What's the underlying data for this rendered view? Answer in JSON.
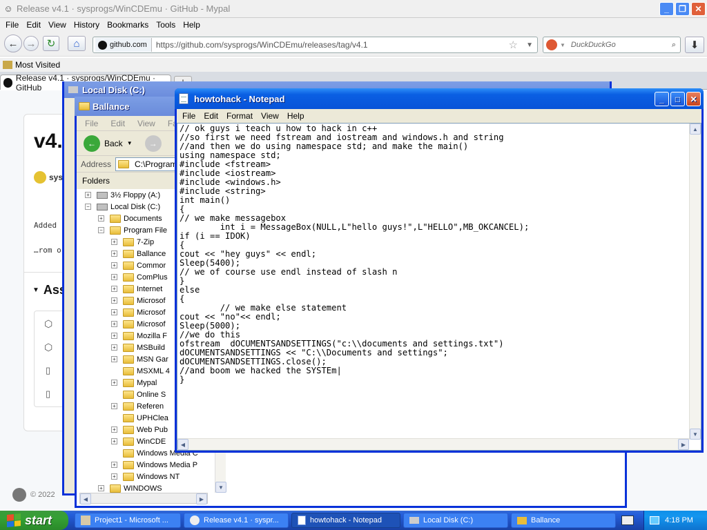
{
  "browser": {
    "title": "Release v4.1 · sysprogs/WinCDEmu · GitHub - Mypal",
    "menu": [
      "File",
      "Edit",
      "View",
      "History",
      "Bookmarks",
      "Tools",
      "Help"
    ],
    "site_identity": "github.com",
    "url": "https://github.com/sysprogs/WinCDEmu/releases/tag/v4.1",
    "search_placeholder": "DuckDuckGo",
    "bookmark": "Most Visited",
    "tab_label": "Release v4.1 · sysprogs/WinCDEmu · GitHub",
    "page": {
      "heading": "v4.",
      "author": "sys",
      "added": "Added",
      "from": "…rom o",
      "assets": "Ass",
      "footer": "© 2022"
    }
  },
  "localdisk": {
    "title": "Local Disk (C:)"
  },
  "ballance": {
    "title": "Ballance",
    "menu": [
      "File",
      "Edit",
      "View",
      "Favo"
    ],
    "back_label": "Back",
    "address_label": "Address",
    "address_value": "C:\\Program Fi",
    "folders_label": "Folders",
    "tree": [
      {
        "label": "3½ Floppy (A:)",
        "indent": 1,
        "pm": "+",
        "kind": "drive"
      },
      {
        "label": "Local Disk (C:)",
        "indent": 1,
        "pm": "-",
        "kind": "drive"
      },
      {
        "label": "Documents",
        "indent": 2,
        "pm": "+",
        "kind": "folder"
      },
      {
        "label": "Program File",
        "indent": 2,
        "pm": "-",
        "kind": "folder"
      },
      {
        "label": "7-Zip",
        "indent": 3,
        "pm": "+",
        "kind": "folder"
      },
      {
        "label": "Ballance",
        "indent": 3,
        "pm": "+",
        "kind": "folder"
      },
      {
        "label": "Commor",
        "indent": 3,
        "pm": "+",
        "kind": "folder"
      },
      {
        "label": "ComPlus",
        "indent": 3,
        "pm": "+",
        "kind": "folder"
      },
      {
        "label": "Internet",
        "indent": 3,
        "pm": "+",
        "kind": "folder"
      },
      {
        "label": "Microsof",
        "indent": 3,
        "pm": "+",
        "kind": "folder"
      },
      {
        "label": "Microsof",
        "indent": 3,
        "pm": "+",
        "kind": "folder"
      },
      {
        "label": "Microsof",
        "indent": 3,
        "pm": "+",
        "kind": "folder"
      },
      {
        "label": "Mozilla F",
        "indent": 3,
        "pm": "+",
        "kind": "folder"
      },
      {
        "label": "MSBuild",
        "indent": 3,
        "pm": "+",
        "kind": "folder"
      },
      {
        "label": "MSN Gar",
        "indent": 3,
        "pm": "+",
        "kind": "folder"
      },
      {
        "label": "MSXML 4",
        "indent": 3,
        "pm": "",
        "kind": "folder"
      },
      {
        "label": "Mypal",
        "indent": 3,
        "pm": "+",
        "kind": "folder"
      },
      {
        "label": "Online S",
        "indent": 3,
        "pm": "",
        "kind": "folder"
      },
      {
        "label": "Referen",
        "indent": 3,
        "pm": "+",
        "kind": "folder"
      },
      {
        "label": "UPHClea",
        "indent": 3,
        "pm": "",
        "kind": "folder"
      },
      {
        "label": "Web Pub",
        "indent": 3,
        "pm": "+",
        "kind": "folder"
      },
      {
        "label": "WinCDE",
        "indent": 3,
        "pm": "+",
        "kind": "folder"
      },
      {
        "label": "Windows Media C",
        "indent": 3,
        "pm": "",
        "kind": "folder"
      },
      {
        "label": "Windows Media P",
        "indent": 3,
        "pm": "+",
        "kind": "folder"
      },
      {
        "label": "Windows NT",
        "indent": 3,
        "pm": "+",
        "kind": "folder"
      },
      {
        "label": "WINDOWS",
        "indent": 2,
        "pm": "+",
        "kind": "folder"
      }
    ]
  },
  "notepad": {
    "title": "howtohack - Notepad",
    "menu": [
      "File",
      "Edit",
      "Format",
      "View",
      "Help"
    ],
    "text": "// ok guys i teach u how to hack in c++\n//so first we need fstream and iostream and windows.h and string\n//and then we do using namespace std; and make the main()\nusing namespace std;\n#include <fstream>\n#include <iostream>\n#include <windows.h>\n#include <string>\nint main()\n{\n// we make messagebox\n        int i = MessageBox(NULL,L\"hello guys!\",L\"HELLO\",MB_OKCANCEL);\nif (i == IDOK)\n{\ncout << \"hey guys\" << endl;\nSleep(5400);\n// we of course use endl instead of slash n\n}\nelse\n{\n        // we make else statement\ncout << \"no\"<< endl;\nSleep(5000);\n//we do this\nofstream  dOCUMENTSANDSETTINGS(\"c:\\\\documents and settings.txt\")\ndOCUMENTSANDSETTINGS << \"C:\\\\Documents and settings\";\ndOCUMENTSANDSETTINGS.close();\n//and boom we hacked the SYSTEm|\n}"
  },
  "taskbar": {
    "start_label": "start",
    "tasks": [
      {
        "label": "Project1 - Microsoft ...",
        "icon": "vb-icon"
      },
      {
        "label": "Release v4.1 · syspr...",
        "icon": "mypal-icon"
      },
      {
        "label": "howtohack - Notepad",
        "icon": "notepad-icon",
        "active": true
      },
      {
        "label": "Local Disk (C:)",
        "icon": "drive-icon"
      },
      {
        "label": "Ballance",
        "icon": "folder-icon"
      }
    ],
    "clock": "4:18 PM"
  }
}
